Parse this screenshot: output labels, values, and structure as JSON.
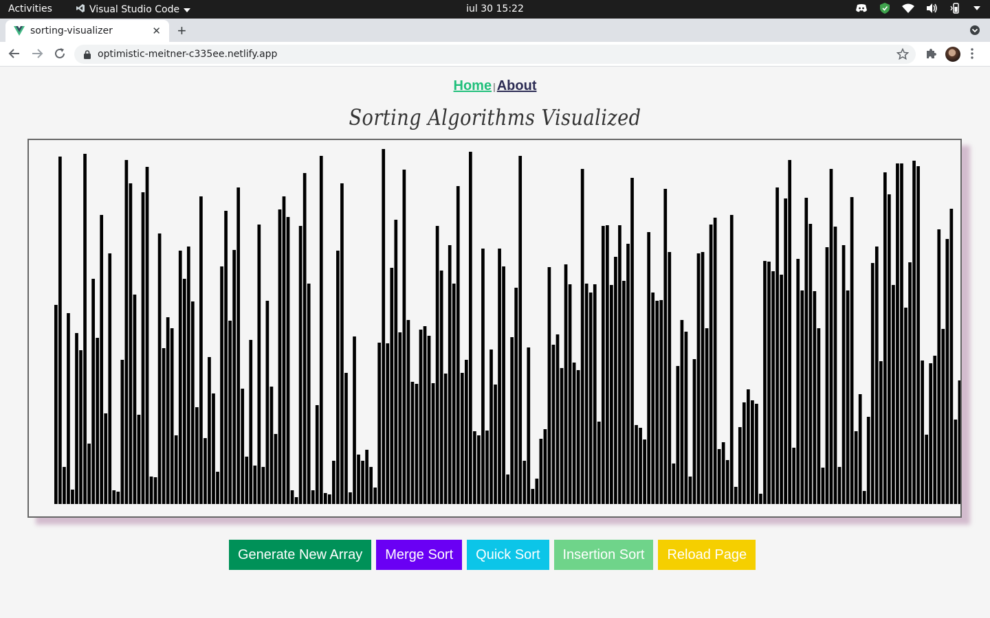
{
  "system_bar": {
    "activities": "Activities",
    "app_name": "Visual Studio Code",
    "clock": "iul 30  15:22"
  },
  "browser": {
    "tab_title": "sorting-visualizer",
    "url": "optimistic-meitner-c335ee.netlify.app"
  },
  "nav": {
    "home": "Home",
    "separator": "|",
    "about": "About"
  },
  "title": "Sorting Algorithms Visualized",
  "buttons": {
    "generate": "Generate New Array",
    "merge": "Merge Sort",
    "quick": "Quick Sort",
    "insertion": "Insertion Sort",
    "reload": "Reload Page"
  },
  "colors": {
    "home_link": "#1fbf7a",
    "about_link": "#2c2c54",
    "bar": "#000000",
    "generate": "#009158",
    "merge": "#6a00f4",
    "quick": "#0cc5e8",
    "insertion": "#6fd48a",
    "reload": "#f5cf00"
  },
  "chart_data": {
    "type": "bar",
    "values": [
      290,
      506,
      54,
      278,
      21,
      249,
      224,
      510,
      88,
      328,
      242,
      421,
      132,
      365,
      20,
      18,
      210,
      501,
      467,
      305,
      130,
      454,
      491,
      40,
      39,
      394,
      227,
      272,
      256,
      100,
      369,
      328,
      375,
      295,
      141,
      448,
      96,
      214,
      161,
      47,
      346,
      427,
      267,
      370,
      461,
      168,
      69,
      239,
      56,
      407,
      54,
      296,
      171,
      102,
      429,
      448,
      418,
      20,
      10,
      405,
      482,
      321,
      20,
      144,
      507,
      16,
      14,
      63,
      369,
      467,
      191,
      17,
      244,
      72,
      63,
      79,
      54,
      24,
      235,
      517,
      234,
      344,
      414,
      250,
      487,
      268,
      178,
      175,
      254,
      259,
      245,
      176,
      405,
      340,
      190,
      377,
      321,
      463,
      191,
      210,
      513,
      106,
      100,
      372,
      107,
      225,
      174,
      372,
      346,
      43,
      243,
      315,
      507,
      63,
      228,
      22,
      37,
      95,
      109,
      345,
      232,
      247,
      198,
      349,
      320,
      206,
      195,
      488,
      321,
      308,
      320,
      120,
      405,
      406,
      319,
      360,
      406,
      325,
      379,
      475,
      115,
      111,
      94,
      396,
      308,
      296,
      297,
      459,
      367,
      59,
      201,
      268,
      251,
      40,
      211,
      365,
      367,
      256,
      407,
      417,
      80,
      90,
      64,
      421,
      25,
      112,
      148,
      167,
      151,
      146,
      15,
      354,
      353,
      339,
      461,
      334,
      445,
      501,
      82,
      357,
      311,
      446,
      408,
      310,
      256,
      53,
      374,
      488,
      404,
      54,
      377,
      311,
      447,
      106,
      160,
      19,
      127,
      351,
      375,
      208,
      483,
      451,
      319,
      496,
      496,
      286,
      352,
      500,
      492,
      209,
      101,
      205,
      216,
      400,
      255,
      386,
      430,
      123,
      180
    ]
  }
}
